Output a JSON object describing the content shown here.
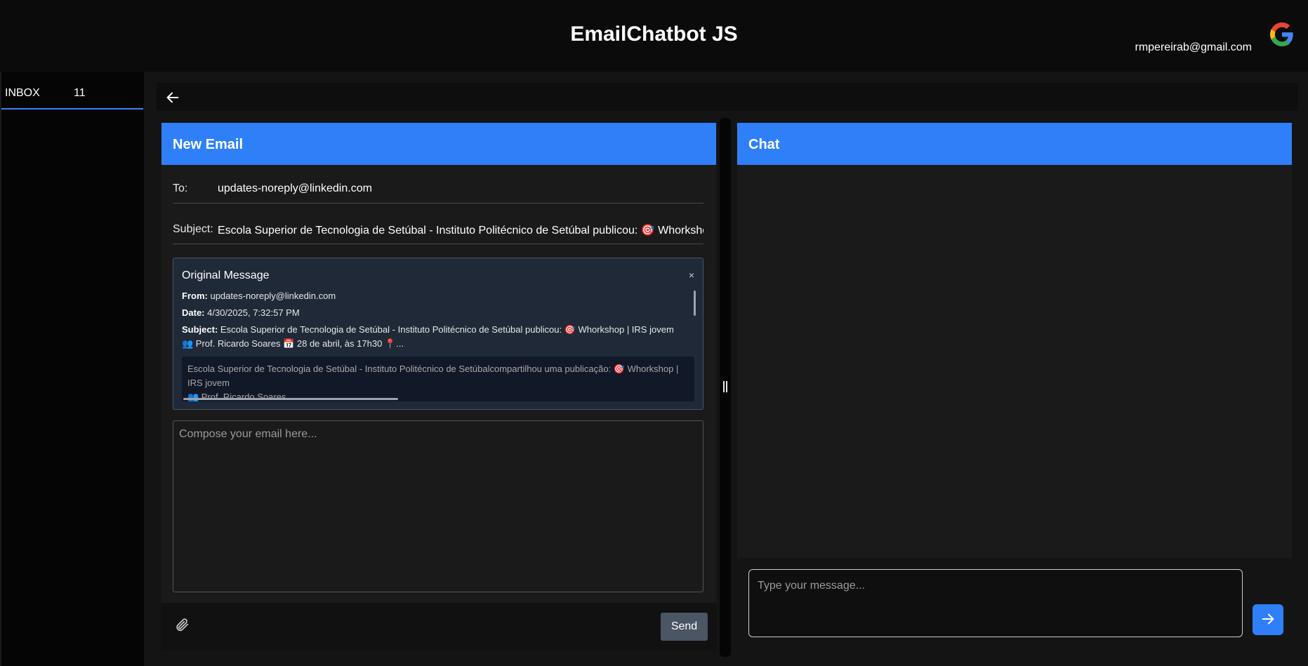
{
  "header": {
    "title": "EmailChatbot JS",
    "user_email": "rmpereirab@gmail.com",
    "logo_icon": "google-icon"
  },
  "sidebar": {
    "items": [
      {
        "label": "INBOX",
        "count": "11"
      }
    ]
  },
  "toolbar": {
    "back_icon": "arrow-left-icon"
  },
  "email": {
    "title": "New Email",
    "to_label": "To:",
    "to_value": "updates-noreply@linkedin.com",
    "subject_label": "Subject:",
    "subject_value": "Escola Superior de Tecnologia de Setúbal - Instituto Politécnico de Setúbal publicou: 🎯 Whorkshop | IRS jovem",
    "original": {
      "title": "Original Message",
      "close": "×",
      "from_label": "From:",
      "from_value": "updates-noreply@linkedin.com",
      "date_label": "Date:",
      "date_value": "4/30/2025, 7:32:57 PM",
      "subject_label": "Subject:",
      "subject_value": "Escola Superior de Tecnologia de Setúbal - Instituto Politécnico de Setúbal publicou: 🎯 Whorkshop | IRS jovem 👥 Prof. Ricardo Soares 📅 28 de abril, às 17h30 📍...",
      "body_line1": "Escola Superior de Tecnologia de Setúbal - Instituto Politécnico de Setúbalcompartilhou uma publicação: 🎯 Whorkshop | IRS jovem",
      "body_line2": "👥 Prof. Ricardo Soares"
    },
    "compose_placeholder": "Compose your email here...",
    "send_label": "Send",
    "attach_icon": "paperclip-icon"
  },
  "chat": {
    "title": "Chat",
    "input_placeholder": "Type your message...",
    "send_icon": "arrow-right-icon"
  },
  "colors": {
    "accent": "#2f80f8",
    "background": "#0b0b0b",
    "panel": "#1a1a1a",
    "send_button": "#4b5563"
  }
}
